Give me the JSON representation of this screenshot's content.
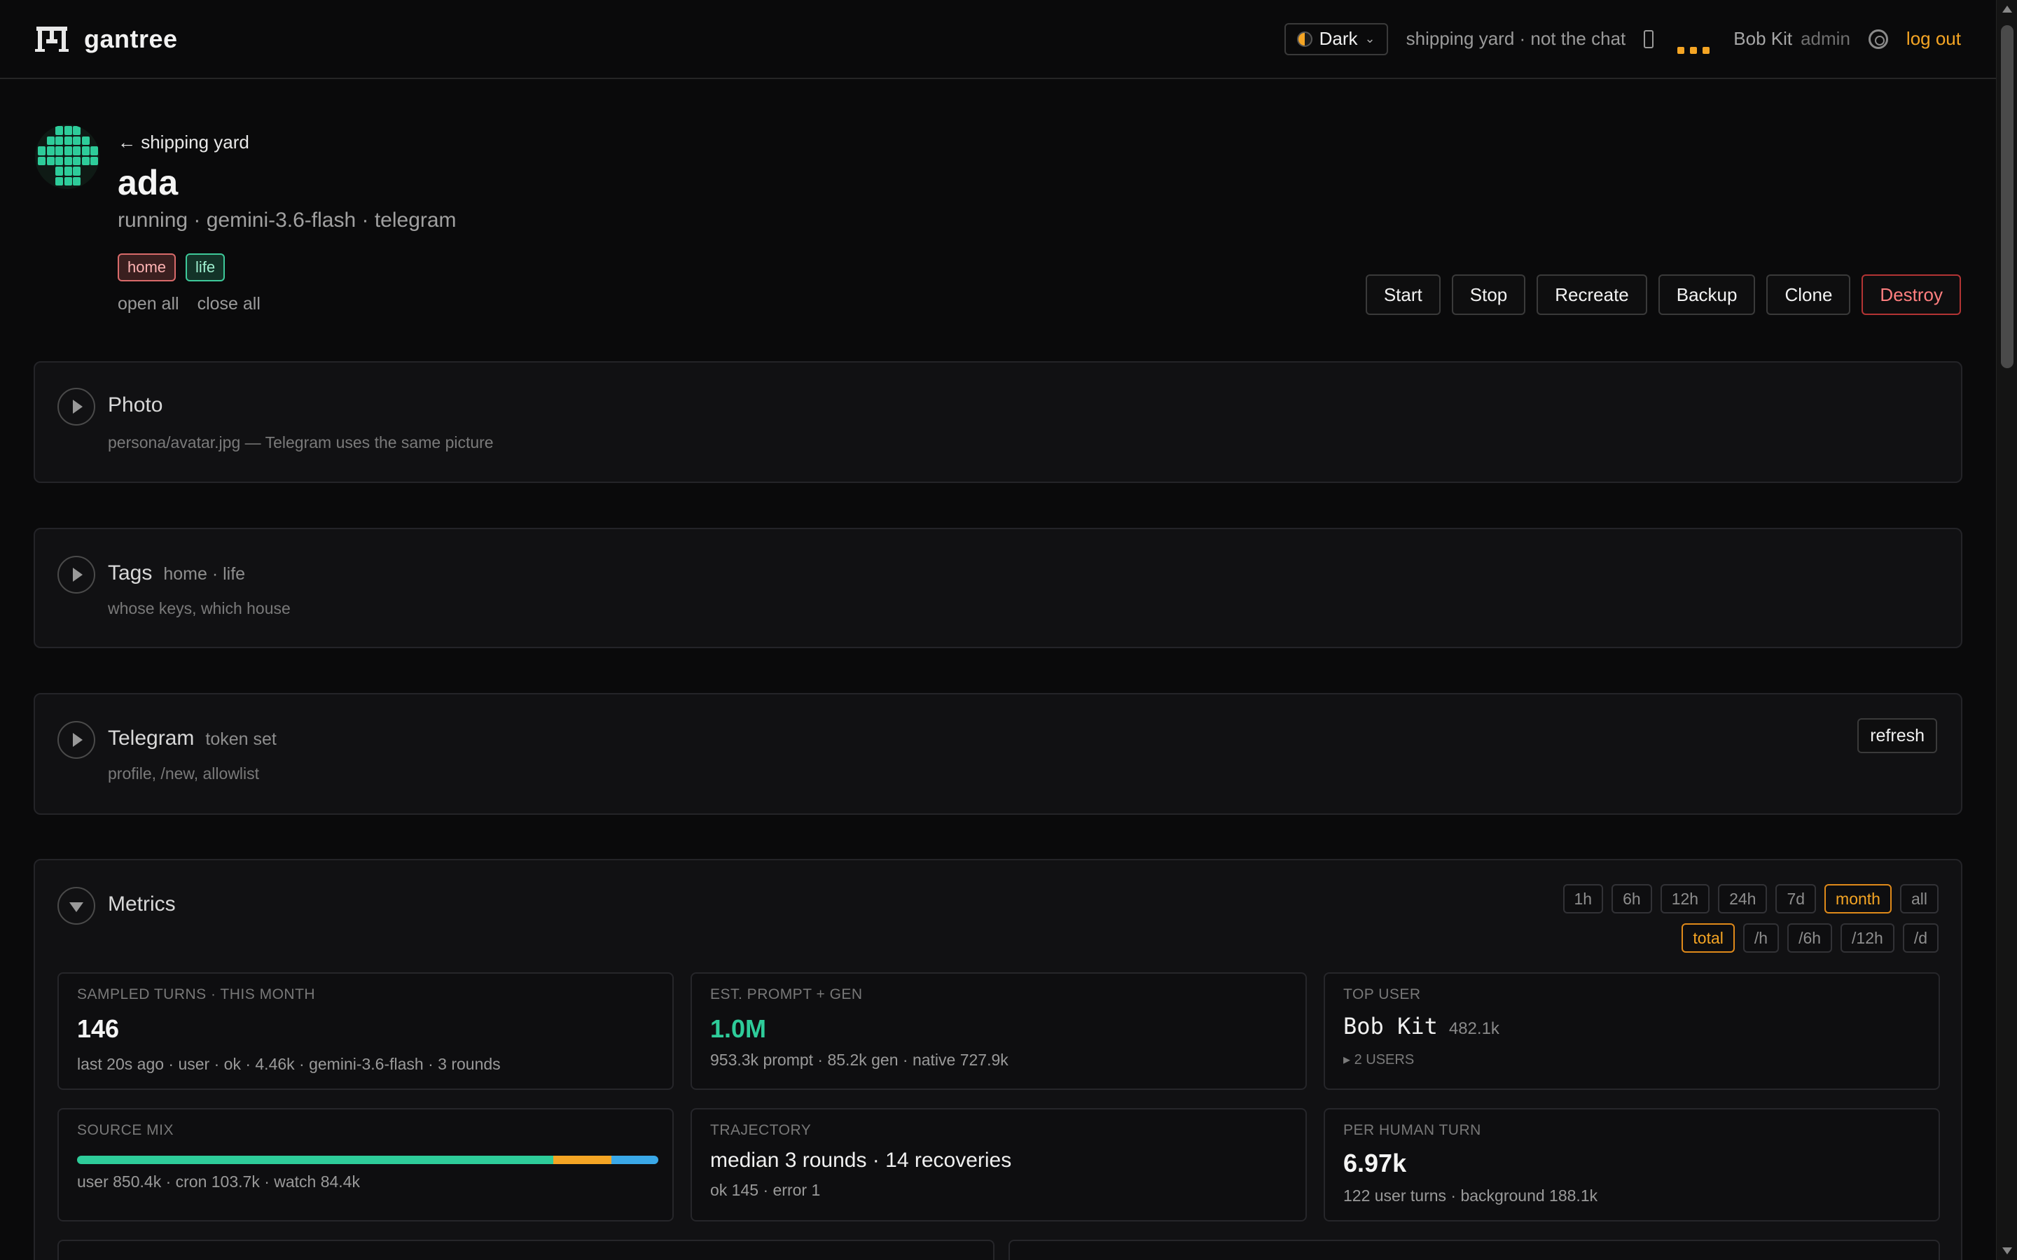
{
  "app": {
    "name": "gantree"
  },
  "header": {
    "theme": "Dark",
    "tagline": "shipping yard · not the chat",
    "user_name": "Bob Kit",
    "user_role": "admin",
    "logout": "log out"
  },
  "agent": {
    "back": "← shipping yard",
    "name": "ada",
    "subtitle": "running · gemini-3.6-flash · telegram",
    "tags": [
      "home",
      "life"
    ],
    "open_all": "open all",
    "close_all": "close all"
  },
  "actions": [
    "Start",
    "Stop",
    "Recreate",
    "Backup",
    "Clone",
    "Destroy"
  ],
  "panels": {
    "photo": {
      "title": "Photo",
      "desc": "persona/avatar.jpg — Telegram uses the same picture"
    },
    "tags": {
      "title": "Tags",
      "aside": "home · life",
      "desc": "whose keys, which house"
    },
    "telegram": {
      "title": "Telegram",
      "aside": "token set",
      "desc": "profile, /new, allowlist",
      "refresh": "refresh"
    },
    "metrics": {
      "title": "Metrics",
      "ranges": [
        "1h",
        "6h",
        "12h",
        "24h",
        "7d",
        "month",
        "all"
      ],
      "active_range": "month",
      "rates": [
        "total",
        "/h",
        "/6h",
        "/12h",
        "/d"
      ],
      "active_rate": "total",
      "cards": {
        "turns": {
          "label": "SAMPLED TURNS · THIS MONTH",
          "value": "146",
          "detail": "last 20s ago · user · ok · 4.46k · gemini-3.6-flash · 3 rounds"
        },
        "prompt": {
          "label": "EST. PROMPT + GEN",
          "value": "1.0M",
          "detail": "953.3k prompt · 85.2k gen · native 727.9k"
        },
        "top_user": {
          "label": "TOP USER",
          "value": "Bob Kit",
          "aside": "482.1k",
          "detail": "▸ 2 USERS"
        },
        "source_mix": {
          "label": "SOURCE MIX",
          "detail": "user 850.4k · cron 103.7k · watch 84.4k",
          "segments": [
            {
              "name": "user",
              "value": 850.4,
              "color": "#2ecc9a"
            },
            {
              "name": "cron",
              "value": 103.7,
              "color": "#f5a524"
            },
            {
              "name": "watch",
              "value": 84.4,
              "color": "#3aa8e8"
            }
          ]
        },
        "trajectory": {
          "label": "TRAJECTORY",
          "value": "median 3 rounds · 14 recoveries",
          "detail": "ok 145 · error 1"
        },
        "per_turn": {
          "label": "PER HUMAN TURN",
          "value": "6.97k",
          "detail": "122 user turns · background 188.1k"
        }
      }
    }
  },
  "colors": {
    "accent": "#f5a524",
    "green": "#2ecc9a",
    "danger": "#ff7f7f"
  }
}
